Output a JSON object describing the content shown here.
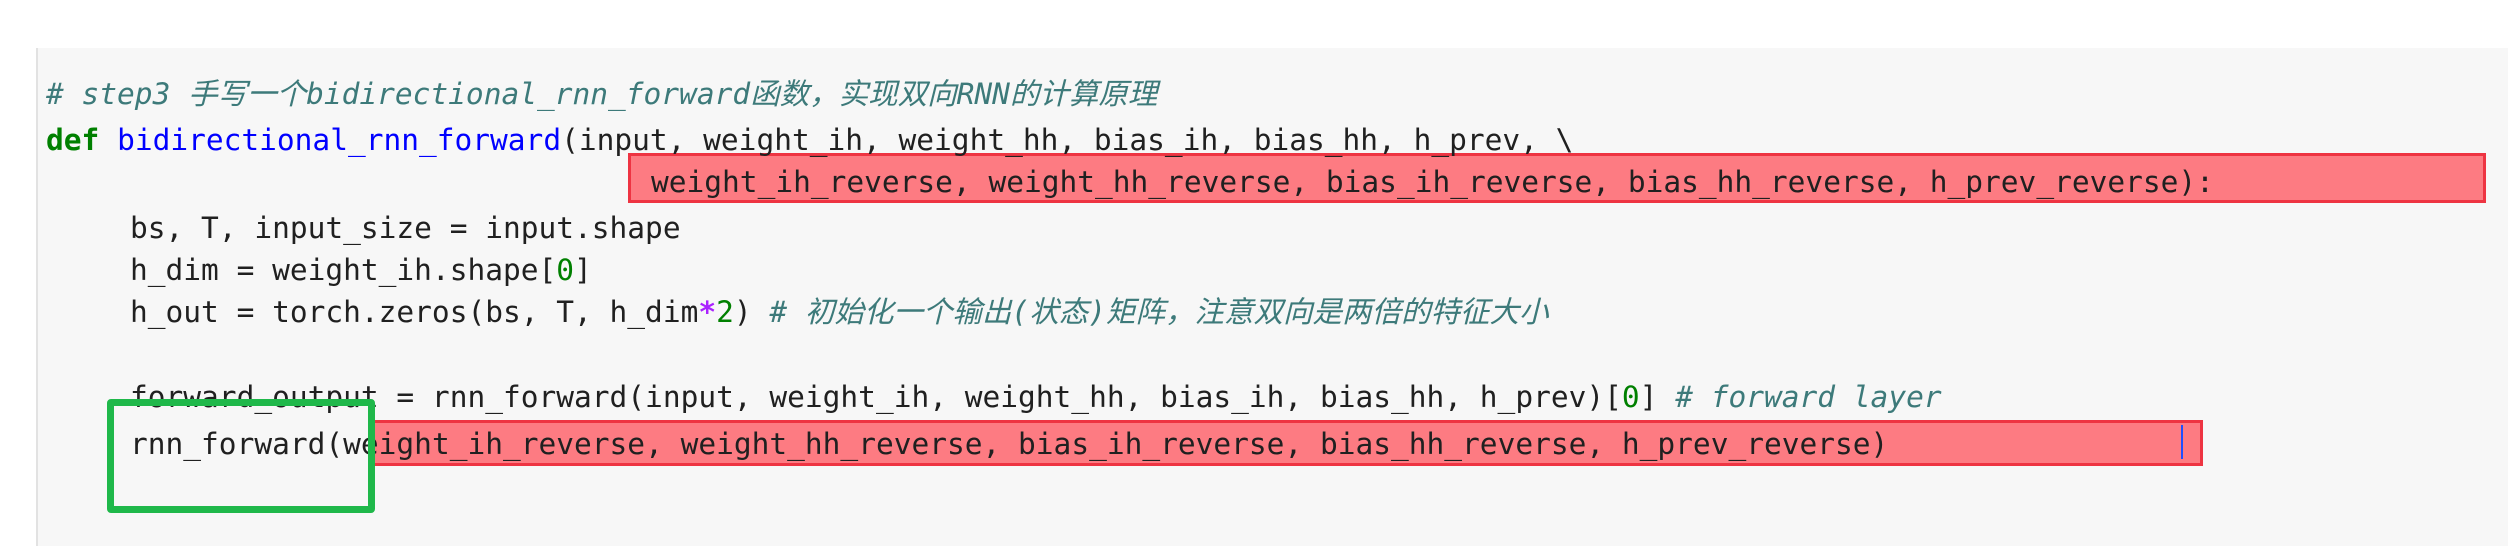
{
  "editor": {
    "line1_comment": "# step3 手写一个bidirectional_rnn_forward函数，实现双向RNN的计算原理",
    "line2_def": "def",
    "line2_name": "bidirectional_rnn_forward",
    "line2_params": "(input, weight_ih, weight_hh, bias_ih, bias_hh, h_prev, \\",
    "line3_params": "weight_ih_reverse, weight_hh_reverse, bias_ih_reverse, bias_hh_reverse, h_prev_reverse):",
    "line4": "bs, T, input_size = input.shape",
    "line5_a": "h_dim = weight_ih.shape[",
    "line5_num": "0",
    "line5_b": "]",
    "line6_a": "h_out = torch.zeros(bs, T, h_dim",
    "line6_op": "*",
    "line6_num": "2",
    "line6_b": ") ",
    "line6_comment": "# 初始化一个输出(状态)矩阵，注意双向是两倍的特征大小",
    "line8_code": "forward_output = rnn_forward(input, weight_ih, weight_hh, bias_ih, bias_hh, h_prev)[",
    "line8_num": "0",
    "line8_close": "] ",
    "line8_comment": "# forward layer",
    "line9_name": "rnn_forward",
    "line9_args": "(weight_ih_reverse, weight_hh_reverse, bias_ih_reverse, bias_hh_reverse, h_prev_reverse)"
  },
  "colors": {
    "highlight": "#ff4650",
    "annotation_box": "#1fb84a",
    "cell_background": "#f7f7f7"
  }
}
